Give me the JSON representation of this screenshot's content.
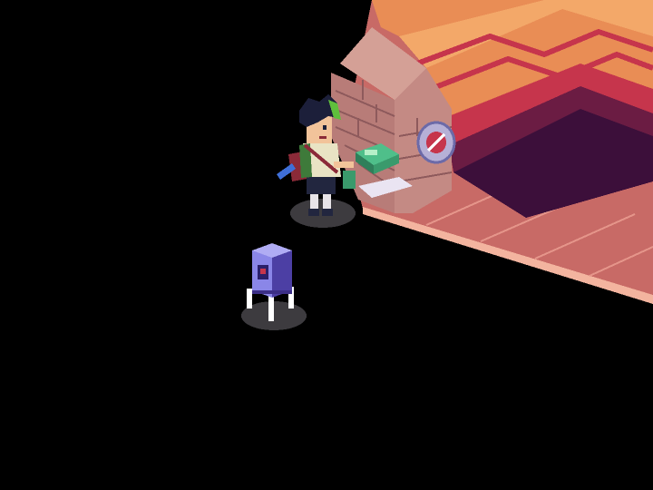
{
  "scene": {
    "type": "isometric-pixel-art",
    "background_color": "#000000",
    "palette": {
      "floor_light": "#e5958a",
      "floor_mid": "#c86a66",
      "floor_edge": "#f3b49f",
      "stair_orange": "#e98d55",
      "stair_orange_light": "#f3a869",
      "stair_red": "#c6354c",
      "stair_maroon": "#6b1c43",
      "stair_purple": "#3c0f3a",
      "wall_brick": "#b87c78",
      "wall_brick_dark": "#8e5a5c",
      "wall_cap": "#d4a096",
      "character_skin": "#f2c39a",
      "character_hair": "#1c1f3a",
      "character_hair_accent": "#5fbf3c",
      "character_shirt": "#e9e3c4",
      "character_pants": "#22263f",
      "robot_body": "#8a86e8",
      "robot_body_dark": "#4c3fa4",
      "shadow": "#3d3b3f"
    },
    "objects": [
      {
        "name": "floor-platform",
        "kind": "isometric floor"
      },
      {
        "name": "staircase",
        "kind": "isometric stairs"
      },
      {
        "name": "brick-wall",
        "kind": "low brick wall"
      },
      {
        "name": "wall-emblem",
        "kind": "round sign",
        "icon": "shield-emblem-icon"
      },
      {
        "name": "player-character",
        "kind": "protagonist with green-streaked dark hair and satchel"
      },
      {
        "name": "green-device",
        "kind": "handheld green console held by player"
      },
      {
        "name": "purple-robot",
        "kind": "boxy purple walker robot"
      }
    ]
  }
}
